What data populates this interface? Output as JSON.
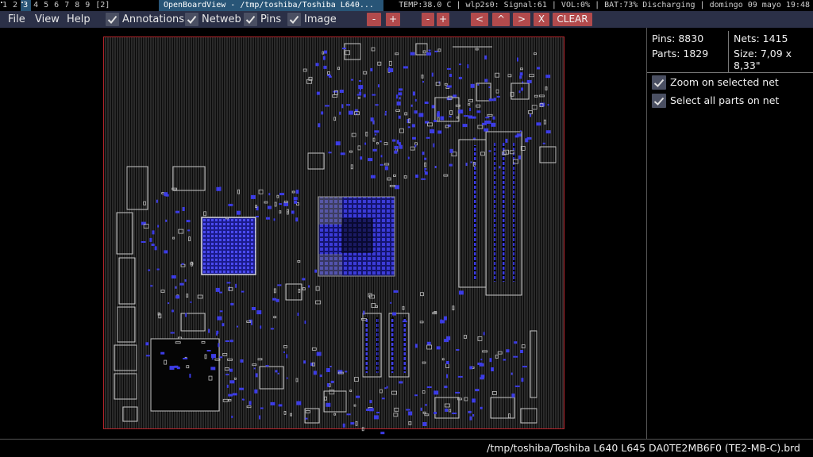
{
  "topbar": {
    "workspaces": [
      {
        "label": "1",
        "urgent": true
      },
      {
        "label": "2",
        "urgent": false
      },
      {
        "label": "3",
        "urgent": true,
        "focused": true
      },
      {
        "label": "4",
        "urgent": false
      },
      {
        "label": "5",
        "urgent": false
      },
      {
        "label": "6",
        "urgent": false
      },
      {
        "label": "7",
        "urgent": false
      },
      {
        "label": "8",
        "urgent": false
      },
      {
        "label": "9",
        "urgent": false
      },
      {
        "label": "[2]",
        "urgent": false
      }
    ],
    "window_title": "OpenBoardView - /tmp/toshiba/Toshiba L640...",
    "status": "TEMP:38.0 C | wlp2s0: Signal:61 | VOL:0% | BAT:73% Discharging | domingo 09 mayo 19:48"
  },
  "menubar": {
    "menus": [
      "File",
      "View",
      "Help"
    ],
    "toggles": [
      {
        "label": "Annotations",
        "checked": true
      },
      {
        "label": "Netweb",
        "checked": true
      },
      {
        "label": "Pins",
        "checked": true
      },
      {
        "label": "Image",
        "checked": true
      }
    ],
    "buttons": {
      "zoom_out_1": "-",
      "zoom_in_1": "+",
      "zoom_out_2": "-",
      "zoom_in_2": "+",
      "left": "<",
      "up": "^",
      "right": ">",
      "close": "X",
      "clear": "CLEAR"
    }
  },
  "sidepanel": {
    "pins": "Pins: 8830",
    "nets": "Nets: 1415",
    "parts": "Parts: 1829",
    "size": "Size: 7,09 x 8,33\"",
    "options": [
      {
        "label": "Zoom on selected net",
        "checked": true
      },
      {
        "label": "Select all parts on net",
        "checked": true
      }
    ]
  },
  "footer": {
    "file_path": "/tmp/toshiba/Toshiba L640 L645 DA0TE2MB6F0 (TE2-MB-C).brd"
  },
  "colors": {
    "board_outline": "#b3242a",
    "pin": "#3c3ce6",
    "part_outline": "#c8c8c8",
    "trace": "#555555",
    "menubar_bg": "#2b3047",
    "toolbar_button": "#b24a4c",
    "focused_workspace": "#285577"
  }
}
